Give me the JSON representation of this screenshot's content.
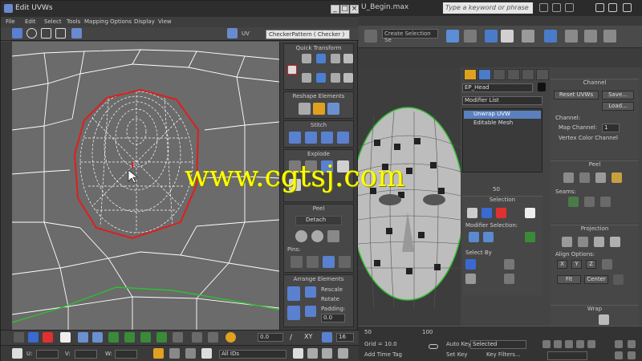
{
  "max": {
    "title": "U_Begin.max",
    "search_placeholder": "Type a keyword or phrase",
    "menu": [
      "",
      ""
    ],
    "selection_set": "Create Selection Se",
    "object_name": "EP_Head",
    "modifier_list": "Modifier List",
    "stack": [
      "Unwrap UVW",
      "Editable Mesh"
    ],
    "panel": {
      "channel_header": "Channel",
      "reset_uvws": "Reset UVWs",
      "save": "Save...",
      "load": "Load...",
      "channel_label": "Channel:",
      "map_channel": "Map Channel:",
      "map_channel_value": "1",
      "vertex_color_channel": "Vertex Color Channel",
      "peel_header": "Peel",
      "seams_label": "Seams:",
      "selection_header": "Selection",
      "modifier_selection": "Modifier Selection:",
      "select_by": "Select By",
      "projection_header": "Projection",
      "align_options": "Align Options:",
      "axes": [
        "X",
        "Y",
        "Z"
      ],
      "fit": "Fit",
      "center": "Center",
      "wrap_header": "Wrap",
      "ruler_values": [
        "50",
        "100"
      ]
    },
    "status": {
      "grid": "Grid = 10.0",
      "add_time_tag": "Add Time Tag",
      "auto_key": "Auto Key",
      "selected": "Selected",
      "set_key": "Set Key",
      "key_filters": "Key Filters..."
    }
  },
  "uvw": {
    "title": "Edit UVWs",
    "menu": [
      "File",
      "Edit",
      "Select",
      "Tools",
      "Mapping",
      "Options",
      "Display",
      "View"
    ],
    "uv_label": "UV",
    "checker": "CheckerPattern  ( Checker )",
    "sections": {
      "quick_transform": "Quick Transform",
      "reshape": "Reshape Elements",
      "stitch": "Stitch",
      "explode": "Explode",
      "peel": "Peel",
      "detach": "Detach",
      "pins": "Pins:",
      "arrange": "Arrange Elements",
      "rescale": "Rescale",
      "rotate": "Rotate",
      "padding": "Padding:",
      "padding_value": "0.0"
    },
    "bottom": {
      "spinner_value": "0.0",
      "xy": "XY",
      "zoom_value": "16",
      "u_label": "U:",
      "v_label": "V:",
      "w_label": "W:",
      "id_filter": "All IDs"
    }
  },
  "watermark": "www.cgtsj.com",
  "colors": {
    "uv_line": "#ffffff",
    "selected_edge": "#e01e1e",
    "green_edge": "#2fbf2f",
    "watermark": "#ffff00"
  }
}
